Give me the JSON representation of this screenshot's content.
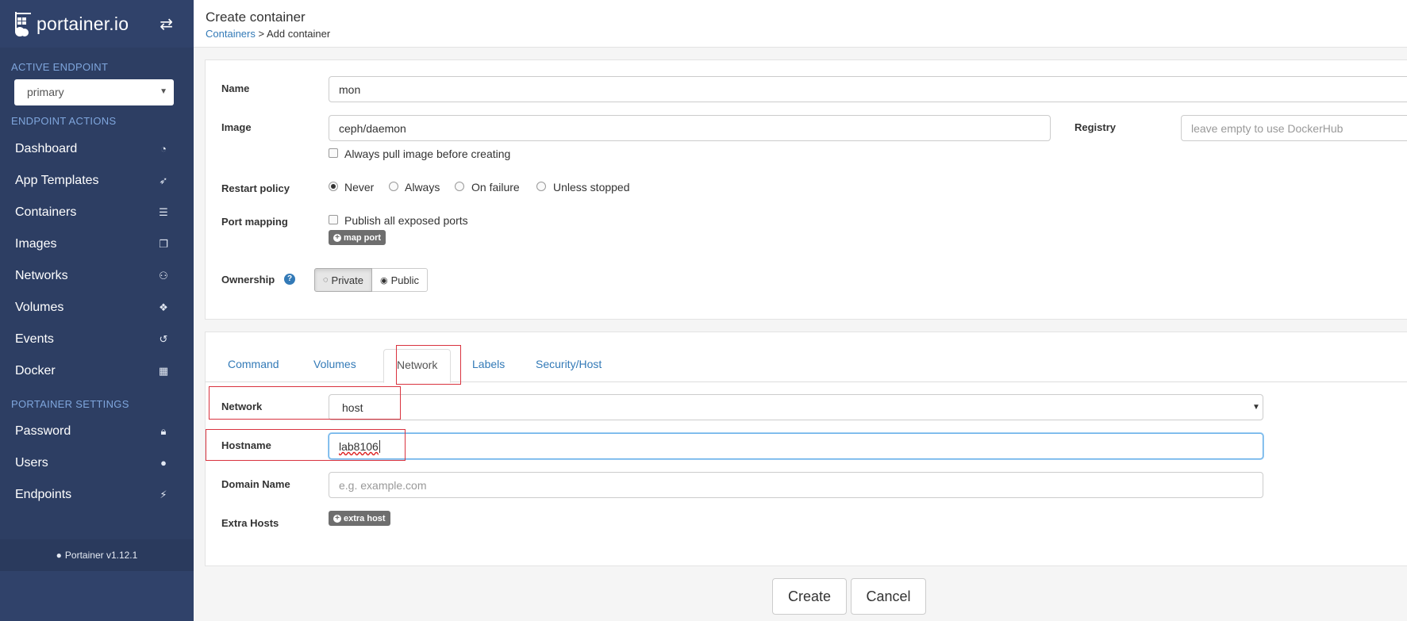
{
  "sidebar": {
    "brand": "portainer.io",
    "active_endpoint_label": "ACTIVE ENDPOINT",
    "endpoint_value": "primary",
    "endpoint_actions_label": "ENDPOINT ACTIONS",
    "items": [
      {
        "label": "Dashboard",
        "icon": "dashboard-icon"
      },
      {
        "label": "App Templates",
        "icon": "rocket-icon"
      },
      {
        "label": "Containers",
        "icon": "server-icon"
      },
      {
        "label": "Images",
        "icon": "clone-icon"
      },
      {
        "label": "Networks",
        "icon": "sitemap-icon"
      },
      {
        "label": "Volumes",
        "icon": "cubes-icon"
      },
      {
        "label": "Events",
        "icon": "history-icon"
      },
      {
        "label": "Docker",
        "icon": "th-icon"
      }
    ],
    "settings_label": "PORTAINER SETTINGS",
    "settings_items": [
      {
        "label": "Password",
        "icon": "lock-icon"
      },
      {
        "label": "Users",
        "icon": "user-icon"
      },
      {
        "label": "Endpoints",
        "icon": "plug-icon"
      }
    ],
    "footer": "Portainer v1.12.1"
  },
  "header": {
    "title": "Create container",
    "breadcrumb_link": "Containers",
    "breadcrumb_sep": " > ",
    "breadcrumb_current": "Add container"
  },
  "form": {
    "name_label": "Name",
    "name_value": "mon",
    "image_label": "Image",
    "image_value": "ceph/daemon",
    "always_pull_label": "Always pull image before creating",
    "registry_label": "Registry",
    "registry_placeholder": "leave empty to use DockerHub",
    "restart_label": "Restart policy",
    "restart_options": [
      "Never",
      "Always",
      "On failure",
      "Unless stopped"
    ],
    "restart_selected": "Never",
    "port_label": "Port mapping",
    "publish_all_label": "Publish all exposed ports",
    "map_port_button": "map port",
    "ownership_label": "Ownership",
    "private_button": "Private",
    "public_button": "Public"
  },
  "tabs": [
    "Command",
    "Volumes",
    "Network",
    "Labels",
    "Security/Host"
  ],
  "active_tab": "Network",
  "network": {
    "network_label": "Network",
    "network_value": "host",
    "hostname_label": "Hostname",
    "hostname_value": "lab8106",
    "domain_label": "Domain Name",
    "domain_placeholder": "e.g. example.com",
    "extra_hosts_label": "Extra Hosts",
    "extra_host_button": "extra host"
  },
  "actions": {
    "create": "Create",
    "cancel": "Cancel"
  },
  "colors": {
    "sidebar": "#2d3e63",
    "link": "#337ab7",
    "highlight": "#d9333f"
  }
}
